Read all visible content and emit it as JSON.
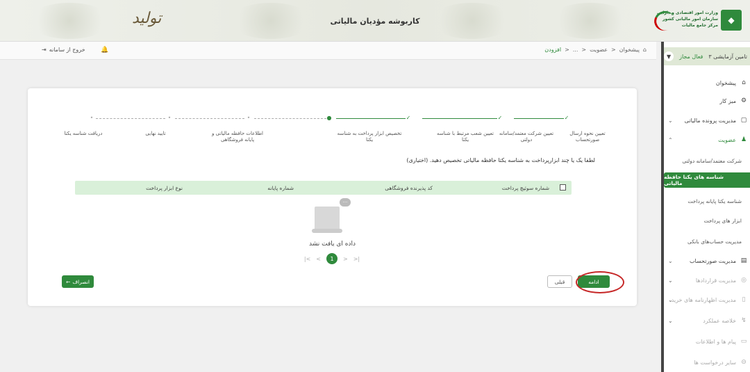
{
  "header": {
    "title": "کاربوشه مؤدیان مالیاتی",
    "logo_left": "تولید",
    "logo_right_lines": [
      "وزارت امور اقتصادی و دارایی",
      "سازمان امور مالیاتی کشور",
      "مرکز جامع مالیات"
    ],
    "colors": {
      "brand": "#2f8a3c",
      "highlight": "#c62828"
    }
  },
  "topbar": {
    "exit_label": "خروج از سامانه",
    "exit_icon": "exit-icon",
    "bell_icon": "bell-icon",
    "breadcrumb": [
      "پیشخوان",
      "عضویت",
      "...",
      "افزودن"
    ]
  },
  "sidebar": {
    "user_name": "تامین آزمایشی ۳",
    "user_status": "فعال مجاز",
    "items": [
      {
        "label": "پیشخوان",
        "icon": "home-icon"
      },
      {
        "label": "میز کار",
        "icon": "workspace-icon"
      },
      {
        "label": "مدیریت پرونده مالیاتی",
        "icon": "folder-icon"
      },
      {
        "label": "عضویت",
        "icon": "user-icon"
      },
      {
        "label": "شرکت معتمد/سامانه دولتی"
      },
      {
        "label": "شناسه های یکتا حافظه مالیاتی"
      },
      {
        "label": "شناسه یکتا پایانه پرداخت"
      },
      {
        "label": "ابزار های پرداخت"
      },
      {
        "label": "مدیریت حساب‌های بانکی"
      },
      {
        "label": "مدیریت صورتحساب",
        "icon": "invoice-icon"
      },
      {
        "label": "مدیریت قراردادها",
        "icon": "contract-icon"
      },
      {
        "label": "مدیریت اظهارنامه های خرید",
        "icon": "declaration-icon"
      },
      {
        "label": "خلاصه عملکرد",
        "icon": "summary-icon"
      },
      {
        "label": "پیام ها و اطلاعات",
        "icon": "message-icon"
      },
      {
        "label": "سایر درخواست ها",
        "icon": "request-icon"
      }
    ]
  },
  "wizard": {
    "steps": [
      {
        "label": "تعیین نحوه ارسال صورتحساب",
        "status": "done"
      },
      {
        "label": "تعیین شرکت معتمد/سامانه دولتی",
        "status": "done"
      },
      {
        "label": "تعیین شعب مرتبط با شناسه یکتا",
        "status": "done"
      },
      {
        "label": "تخصیص ابزار پرداخت به شناسه یکتا",
        "status": "current"
      },
      {
        "label": "اطلاعات حافظه مالیاتی و پایانه فروشگاهی",
        "status": "pending"
      },
      {
        "label": "تایید نهایی",
        "status": "pending"
      },
      {
        "label": "دریافت شناسه یکتا",
        "status": "pending"
      }
    ],
    "prompt": "لطفا یک یا چند ابزارپرداخت به شناسه یکتا حافظه مالیاتی تخصیص دهید. (اختیاری)",
    "table_headers": [
      "شماره سوئیچ پرداخت",
      "کد پذیرنده فروشگاهی",
      "شماره پایانه",
      "نوع ابزار پرداخت"
    ],
    "empty_text": "داده ای یافت نشد",
    "empty_bubble": "...",
    "pager": {
      "current": "1",
      "first": "|<",
      "prev": "<",
      "next": ">",
      "last": ">|"
    },
    "buttons": {
      "continue": "ادامه",
      "back": "قبلی",
      "cancel": "انصراف"
    }
  }
}
